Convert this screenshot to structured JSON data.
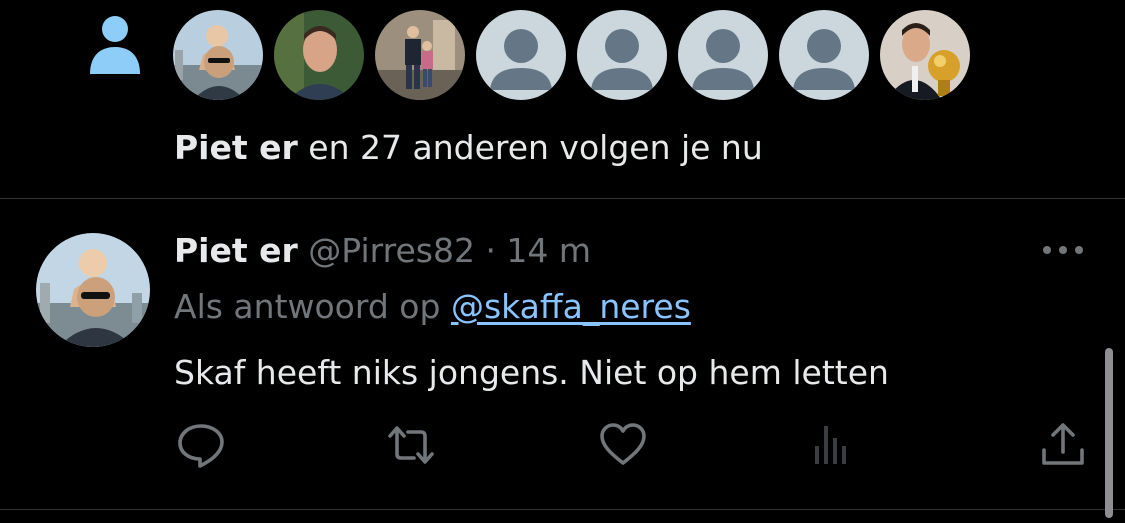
{
  "colors": {
    "background": "#000000",
    "text_primary": "#e7e9ea",
    "text_secondary": "#71767b",
    "link": "#8ac4ff",
    "follow_icon": "#8ecdf8",
    "divider": "#2f3336",
    "default_avatar_bg": "#ccd6dd",
    "default_avatar_fg": "#657786"
  },
  "follow_notification": {
    "icon": "person-icon",
    "avatars": [
      {
        "kind": "photo",
        "desc": "man-with-child-avatar"
      },
      {
        "kind": "photo",
        "desc": "man-portrait-avatar"
      },
      {
        "kind": "photo",
        "desc": "people-standing-avatar"
      },
      {
        "kind": "default",
        "desc": "default-profile-avatar"
      },
      {
        "kind": "default",
        "desc": "default-profile-avatar"
      },
      {
        "kind": "default",
        "desc": "default-profile-avatar"
      },
      {
        "kind": "default",
        "desc": "default-profile-avatar"
      },
      {
        "kind": "photo",
        "desc": "man-with-trophy-avatar"
      }
    ],
    "name": "Piet er",
    "text": " en 27 anderen volgen je nu"
  },
  "tweet": {
    "display_name": "Piet er",
    "meta": " @Pirres82 · 14 m",
    "reply_prefix": "Als antwoord op ",
    "reply_handle": "@skaffa_neres",
    "text": "Skaf heeft niks jongens. Niet op hem letten",
    "more_icon": "more-dots-icon",
    "actions": [
      {
        "name": "reply",
        "icon": "reply-icon"
      },
      {
        "name": "retweet",
        "icon": "retweet-icon"
      },
      {
        "name": "like",
        "icon": "heart-icon"
      },
      {
        "name": "views",
        "icon": "views-icon"
      },
      {
        "name": "share",
        "icon": "share-icon"
      }
    ]
  }
}
